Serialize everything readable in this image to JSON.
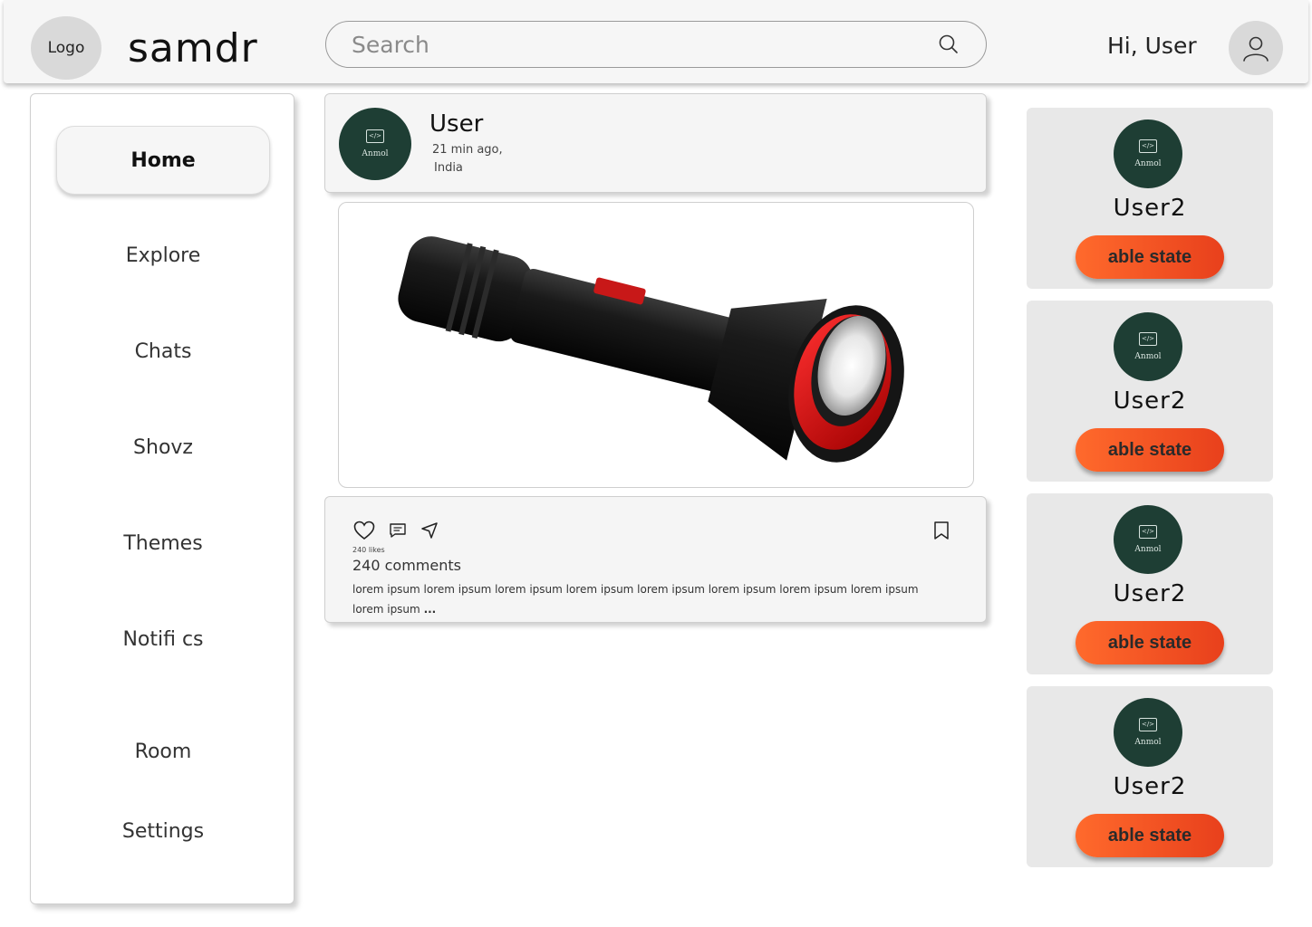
{
  "header": {
    "logo_label": "Logo",
    "brand": "samdr",
    "search_placeholder": "Search",
    "greeting": "Hi, User"
  },
  "sidebar": {
    "items": [
      {
        "label": "Home",
        "active": true
      },
      {
        "label": "Explore"
      },
      {
        "label": "Chats"
      },
      {
        "label": "Shovz"
      },
      {
        "label": "Themes"
      },
      {
        "label": "Notifi cs"
      },
      {
        "label": "Room"
      },
      {
        "label": "Settings"
      }
    ]
  },
  "post": {
    "badge_code": "</>",
    "badge_name": "Anmol",
    "username": "User",
    "time": "21 min ago,",
    "location": "India",
    "likes": "240 likes",
    "comments": "240 comments",
    "caption": "lorem ipsum lorem ipsum lorem ipsum lorem ipsum lorem ipsum lorem ipsum lorem ipsum lorem ipsum lorem ipsum",
    "caption_more": "...",
    "icons": [
      "heart-icon",
      "comment-icon",
      "share-icon",
      "bookmark-icon"
    ]
  },
  "suggestions": [
    {
      "badge_code": "</>",
      "badge_name": "Anmol",
      "name": "User2",
      "button": "able state"
    },
    {
      "badge_code": "</>",
      "badge_name": "Anmol",
      "name": "User2",
      "button": "able state"
    },
    {
      "badge_code": "</>",
      "badge_name": "Anmol",
      "name": "User2",
      "button": "able state"
    },
    {
      "badge_code": "</>",
      "badge_name": "Anmol",
      "name": "User2",
      "button": "able state"
    }
  ],
  "colors": {
    "badge_bg": "#1e3e34",
    "button_start": "#ff6a2c",
    "button_end": "#e8401c",
    "card_bg": "#e8e8e8",
    "header_bg": "#f6f6f6"
  }
}
